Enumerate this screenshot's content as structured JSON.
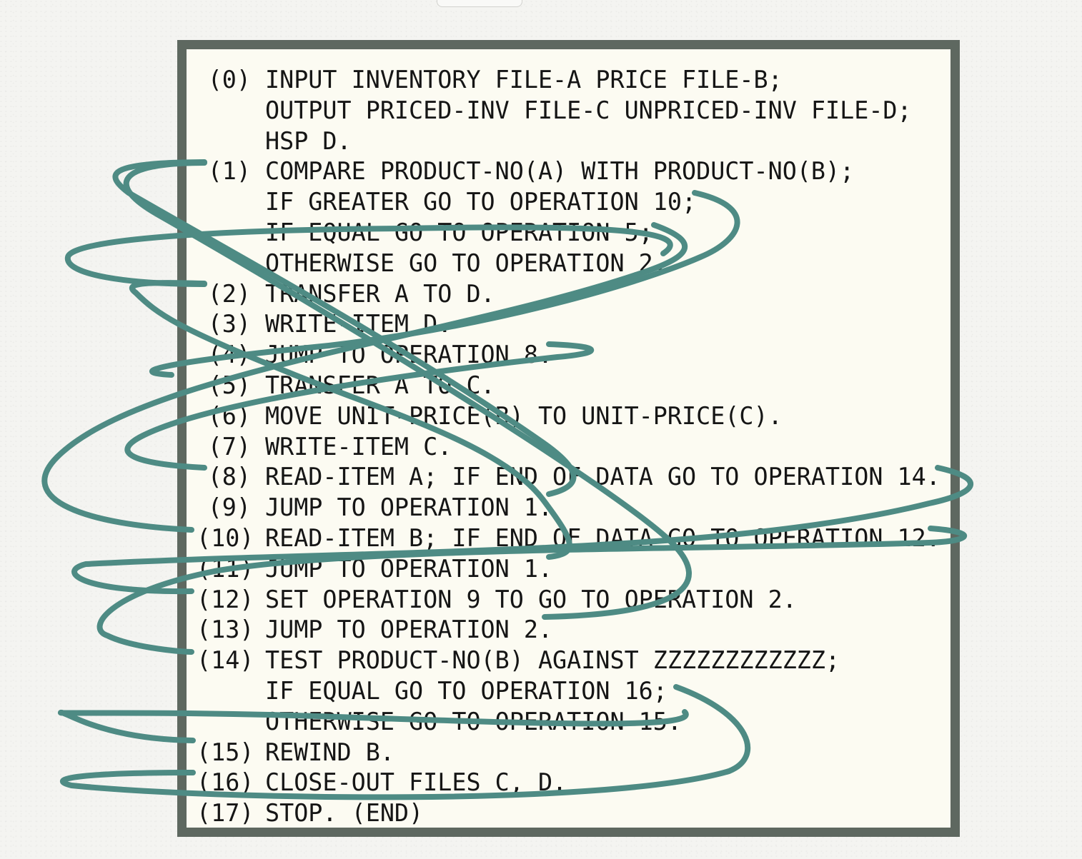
{
  "program": {
    "lines": [
      {
        "num": "(0)",
        "text": "INPUT INVENTORY FILE-A PRICE FILE-B;"
      },
      {
        "num": "",
        "text": "OUTPUT PRICED-INV FILE-C UNPRICED-INV FILE-D;"
      },
      {
        "num": "",
        "text": "HSP D."
      },
      {
        "num": "(1)",
        "text": "COMPARE PRODUCT-NO(A) WITH PRODUCT-NO(B);"
      },
      {
        "num": "",
        "text": "IF GREATER GO TO OPERATION 10;"
      },
      {
        "num": "",
        "text": "IF EQUAL GO TO OPERATION 5;"
      },
      {
        "num": "",
        "text": "OTHERWISE GO TO OPERATION 2."
      },
      {
        "num": "(2)",
        "text": "TRANSFER A TO D."
      },
      {
        "num": "(3)",
        "text": "WRITE-ITEM D."
      },
      {
        "num": "(4)",
        "text": "JUMP TO OPERATION 8."
      },
      {
        "num": "(5)",
        "text": "TRANSFER A TO C."
      },
      {
        "num": "(6)",
        "text": "MOVE UNIT-PRICE(B) TO UNIT-PRICE(C)."
      },
      {
        "num": "(7)",
        "text": "WRITE-ITEM C."
      },
      {
        "num": "(8)",
        "text": "READ-ITEM A; IF END OF DATA GO TO OPERATION 14."
      },
      {
        "num": "(9)",
        "text": "JUMP TO OPERATION 1."
      },
      {
        "num": "(10)",
        "text": "READ-ITEM B; IF END OF DATA GO TO OPERATION 12."
      },
      {
        "num": "(11)",
        "text": "JUMP TO OPERATION 1."
      },
      {
        "num": "(12)",
        "text": "SET OPERATION 9 TO GO TO OPERATION 2."
      },
      {
        "num": "(13)",
        "text": "JUMP TO OPERATION 2."
      },
      {
        "num": "(14)",
        "text": "TEST PRODUCT-NO(B) AGAINST ZZZZZZZZZZZZ;"
      },
      {
        "num": "",
        "text": "IF EQUAL GO TO OPERATION 16;"
      },
      {
        "num": "",
        "text": "OTHERWISE GO TO OPERATION 15."
      },
      {
        "num": "(15)",
        "text": "REWIND B."
      },
      {
        "num": "(16)",
        "text": "CLOSE-OUT FILES C, D."
      },
      {
        "num": "(17)",
        "text": "STOP. (END)"
      }
    ]
  },
  "jumps": [
    {
      "from_line": 4,
      "to_line": 15
    },
    {
      "from_line": 5,
      "to_line": 10
    },
    {
      "from_line": 6,
      "to_line": 7
    },
    {
      "from_line": 9,
      "to_line": 13
    },
    {
      "from_line": 13,
      "to_line": 19
    },
    {
      "from_line": 14,
      "to_line": 3
    },
    {
      "from_line": 15,
      "to_line": 17
    },
    {
      "from_line": 16,
      "to_line": 3
    },
    {
      "from_line": 18,
      "to_line": 7
    },
    {
      "from_line": 20,
      "to_line": 23
    },
    {
      "from_line": 21,
      "to_line": 22
    }
  ],
  "colors": {
    "arrow": "#4e8b84",
    "frame": "#5e6860",
    "paper": "#fcfbf2",
    "text": "#151515"
  }
}
